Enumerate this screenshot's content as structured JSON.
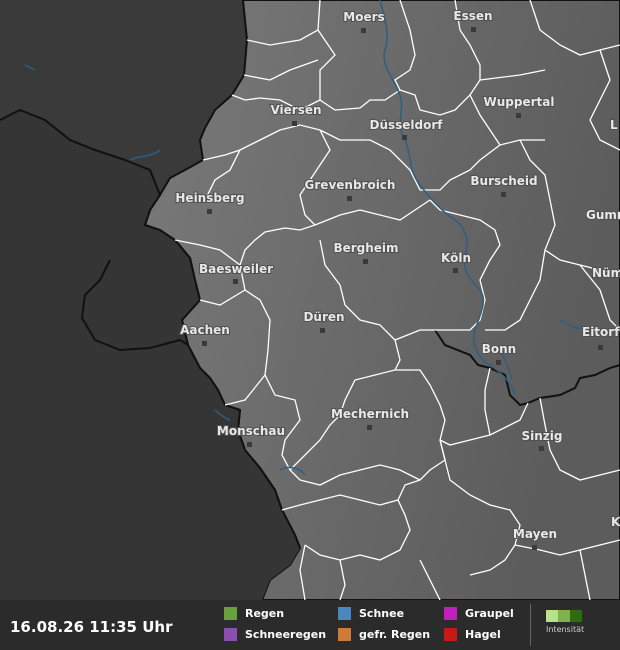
{
  "timestamp": "16.08.26 11:35 Uhr",
  "cities": [
    {
      "name": "Moers"
    },
    {
      "name": "Essen"
    },
    {
      "name": "Viersen"
    },
    {
      "name": "Düsseldorf"
    },
    {
      "name": "Wuppertal"
    },
    {
      "name": "L"
    },
    {
      "name": "Heinsberg"
    },
    {
      "name": "Grevenbroich"
    },
    {
      "name": "Burscheid"
    },
    {
      "name": "Gumm"
    },
    {
      "name": "Bergheim"
    },
    {
      "name": "Baesweiler"
    },
    {
      "name": "Köln"
    },
    {
      "name": "Nüm"
    },
    {
      "name": "Aachen"
    },
    {
      "name": "Düren"
    },
    {
      "name": "Eitorf"
    },
    {
      "name": "Bonn"
    },
    {
      "name": "Mechernich"
    },
    {
      "name": "Monschau"
    },
    {
      "name": "Sinzig"
    },
    {
      "name": "Mayen"
    },
    {
      "name": "K"
    }
  ],
  "legend": {
    "items": [
      {
        "label": "Regen",
        "color": "#6aa03c"
      },
      {
        "label": "Schneeregen",
        "color": "#8a4fb0"
      },
      {
        "label": "Schnee",
        "color": "#4a86c0"
      },
      {
        "label": "gefr. Regen",
        "color": "#d07a3a"
      },
      {
        "label": "Graupel",
        "color": "#c020c0"
      },
      {
        "label": "Hagel",
        "color": "#c81818"
      }
    ],
    "intensity_label": "Intensität",
    "intensity_colors": [
      "#b6e388",
      "#7fb24a",
      "#2f6b10"
    ]
  },
  "colors": {
    "foreign_land": "#3a3a3a",
    "home_land": "#666666",
    "river": "#2f5f80",
    "district_border": "#ffffff",
    "country_border": "#111111"
  }
}
